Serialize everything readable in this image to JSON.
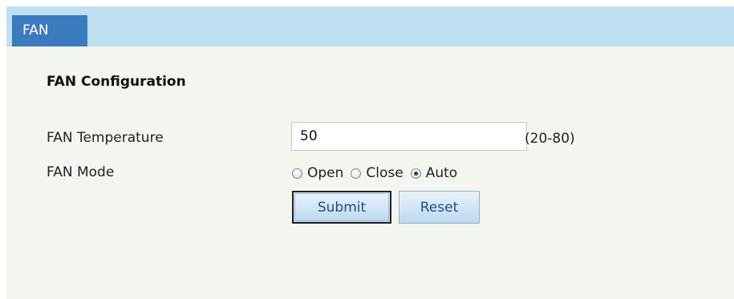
{
  "tab": {
    "label": "FAN"
  },
  "section": {
    "title": "FAN Configuration"
  },
  "temperature": {
    "label": "FAN Temperature",
    "value": "50",
    "range": "(20-80)"
  },
  "mode": {
    "label": "FAN Mode",
    "options": [
      {
        "label": "Open",
        "checked": false
      },
      {
        "label": "Close",
        "checked": false
      },
      {
        "label": "Auto",
        "checked": true
      }
    ]
  },
  "buttons": {
    "submit": "Submit",
    "reset": "Reset"
  },
  "colors": {
    "tab_bar": "#bfe0f0",
    "tab_active": "#3a7bbf",
    "panel": "#f3f5ef"
  }
}
